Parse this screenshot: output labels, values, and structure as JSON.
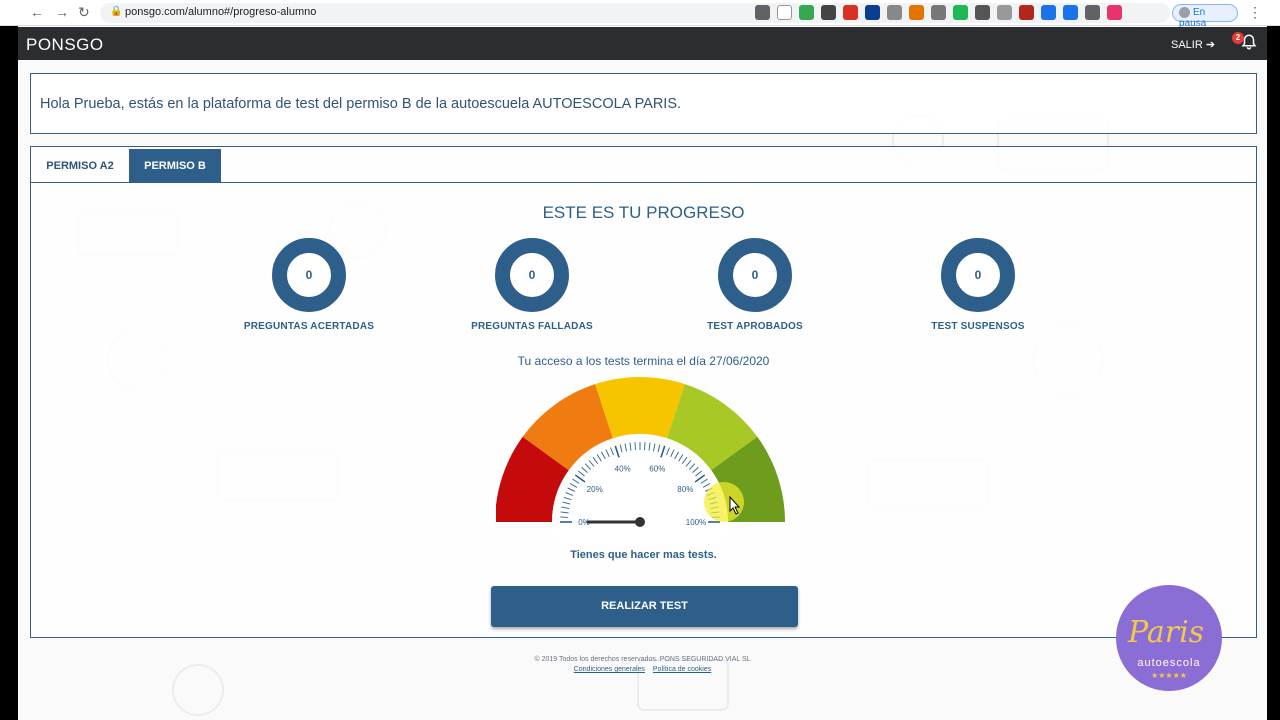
{
  "browser": {
    "url": "ponsgo.com/alumno#/progreso-alumno",
    "profile_status": "En pausa"
  },
  "header": {
    "brand": "PONSGO",
    "logout_label": "SALIR",
    "notification_count": "2"
  },
  "greeting": "Hola Prueba, estás en la plataforma de test del permiso B de la autoescuela AUTOESCOLA PARIS.",
  "tabs": [
    {
      "label": "PERMISO A2",
      "active": false
    },
    {
      "label": "PERMISO B",
      "active": true
    }
  ],
  "progress": {
    "title": "ESTE ES TU PROGRESO",
    "stats": [
      {
        "value": "0",
        "label": "PREGUNTAS ACERTADAS"
      },
      {
        "value": "0",
        "label": "PREGUNTAS FALLADAS"
      },
      {
        "value": "0",
        "label": "TEST APROBADOS"
      },
      {
        "value": "0",
        "label": "TEST SUSPENSOS"
      }
    ],
    "access_text": "Tu acceso a los tests termina el día 27/06/2020",
    "gauge": {
      "value_percent": 0,
      "tick_labels": [
        "0%",
        "20%",
        "40%",
        "60%",
        "80%",
        "100%"
      ],
      "colors": [
        "#c40a0a",
        "#f07b10",
        "#f7c500",
        "#a7c825",
        "#6e9c1c"
      ]
    },
    "message": "Tienes que hacer mas tests.",
    "button_label": "REALIZAR TEST"
  },
  "footer": {
    "copyright": "© 2019 Todos los derechos reservados. PONS SEGURIDAD VIAL SL",
    "link_terms": "Condiciones generales",
    "link_cookies": "Política de cookies"
  },
  "overlay_logo": {
    "script": "Paris",
    "subtitle": "autoescola",
    "stars": "★★★★★"
  },
  "accent_color": "#2d5f8a"
}
